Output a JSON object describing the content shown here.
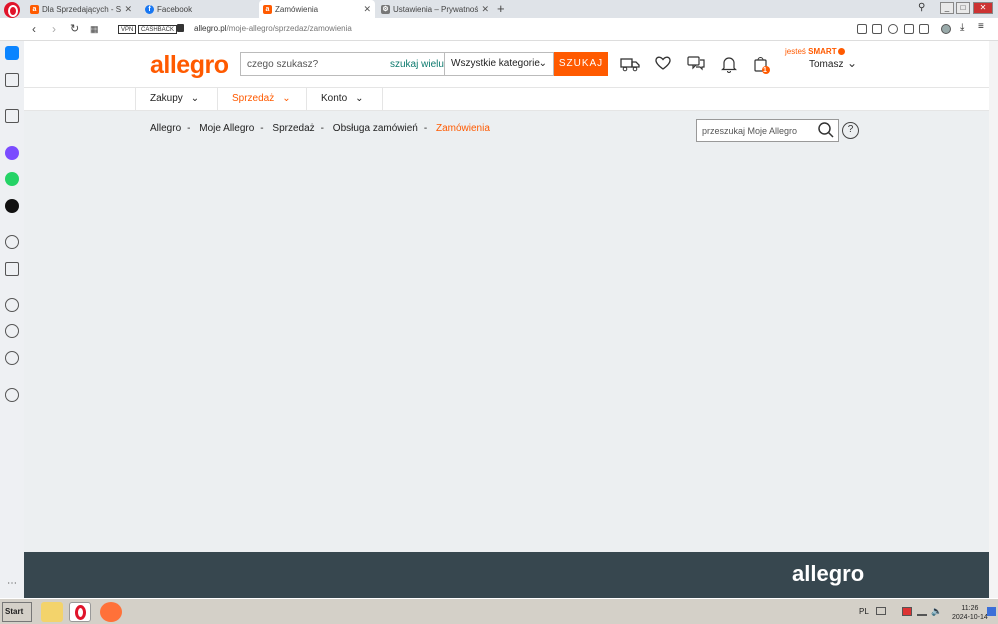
{
  "browser": {
    "tabs": [
      {
        "title": "Dla Sprzedających - Społeczn",
        "favicon_color": "#ff5a00",
        "favicon_letter": "a",
        "active": false
      },
      {
        "title": "Facebook",
        "favicon_color": "#1877f2",
        "favicon_letter": "f",
        "active": false
      },
      {
        "title": "Zamówienia",
        "favicon_color": "#ff5a00",
        "favicon_letter": "a",
        "active": true
      },
      {
        "title": "Ustawienia – Prywatność i bez",
        "favicon_color": "#777777",
        "favicon_letter": "⚙",
        "active": false
      }
    ],
    "vpn_label": "VPN",
    "cashback_label": "CASHBACK",
    "url_host": "allegro.pl",
    "url_path": "/moje-allegro/sprzedaz/zamowienia"
  },
  "header": {
    "logo": "allegro",
    "search_placeholder": "czego szukasz?",
    "search_multi": "szukaj wielu",
    "category": "Wszystkie kategorie",
    "search_button": "SZUKAJ",
    "smart_prefix": "jesteś",
    "smart_word": "SMART",
    "cart_count": "1",
    "username": "Tomasz"
  },
  "nav": {
    "items": [
      {
        "label": "Zakupy",
        "active": false
      },
      {
        "label": "Sprzedaż",
        "active": true
      },
      {
        "label": "Konto",
        "active": false
      }
    ]
  },
  "breadcrumb": [
    "Allegro",
    "Moje Allegro",
    "Sprzedaż",
    "Obsługa zamówień",
    "Zamówienia"
  ],
  "my_allegro_search": {
    "placeholder": "przeszukaj Moje Allegro",
    "help": "?"
  },
  "footer": {
    "logo": "allegro"
  },
  "taskbar": {
    "start_label": "Start",
    "lang": "PL",
    "time": "11:26",
    "date": "2024-10-14"
  },
  "colors": {
    "accent": "#ff5a00",
    "footer": "#37474f",
    "page_bg": "#eceff1"
  }
}
